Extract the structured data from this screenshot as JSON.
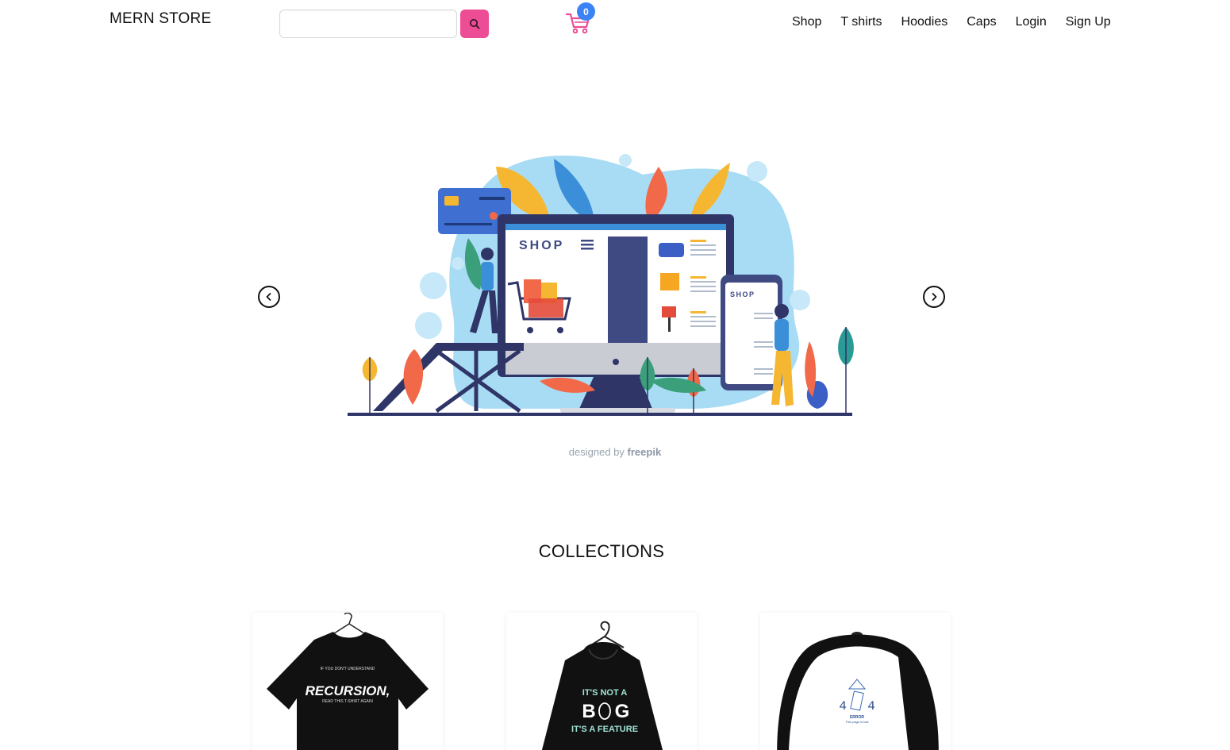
{
  "header": {
    "brand": "MERN STORE",
    "search": {
      "value": "",
      "placeholder": ""
    },
    "cart": {
      "count": "0"
    },
    "nav": [
      "Shop",
      "T shirts",
      "Hoodies",
      "Caps",
      "Login",
      "Sign Up"
    ]
  },
  "hero": {
    "screen_title": "SHOP",
    "phone_title": "SHOP",
    "credit_prefix": "designed by",
    "credit_brand": "freepik"
  },
  "collections": {
    "title": "COLLECTIONS",
    "items": [
      {
        "name": "recursion-tshirt",
        "shirt_text_top": "IF YOU DON'T UNDERSTAND",
        "shirt_text_main": "RECURSION,",
        "shirt_text_bottom": "READ THIS T-SHIRT AGAIN"
      },
      {
        "name": "bug-feature-hoodie",
        "line1": "IT'S NOT A",
        "line2a": "B",
        "line2b": "G",
        "line3": "IT'S A FEATURE"
      },
      {
        "name": "404-cap",
        "code_a": "4",
        "code_b": "4",
        "error": "ERROR",
        "sub": "This page is lost"
      }
    ]
  },
  "colors": {
    "accent_pink": "#ec4d95",
    "badge_blue": "#3b82f6"
  }
}
